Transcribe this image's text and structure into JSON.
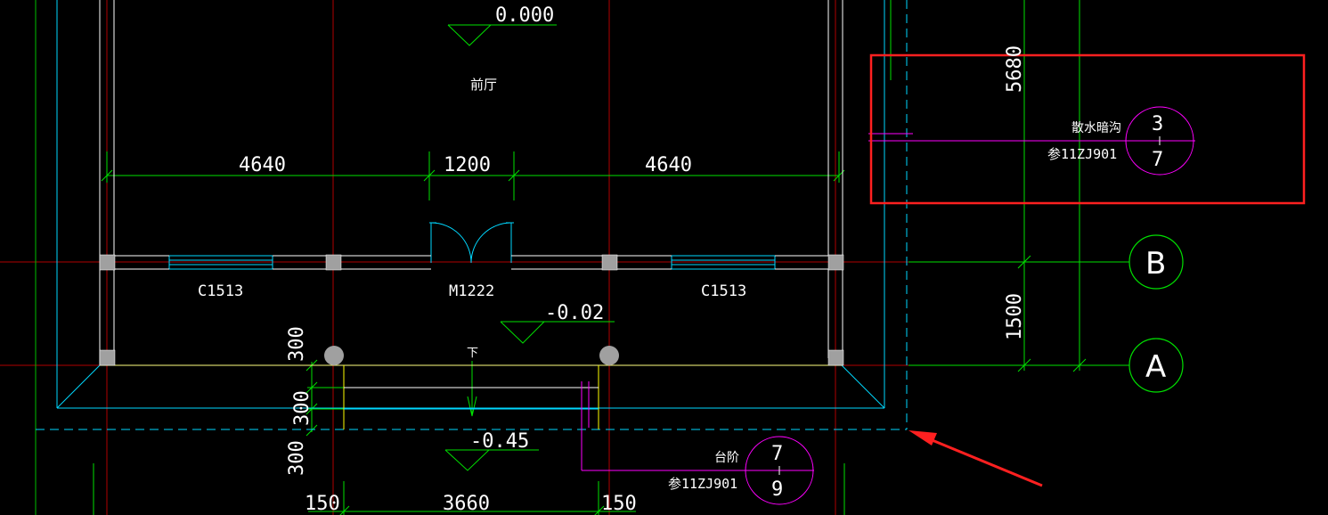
{
  "drawing": {
    "elevations": {
      "top": "0.000",
      "door": "-0.02",
      "bottom": "-0.45"
    },
    "room_label": "前厅",
    "dimensions": {
      "top_left": "4640",
      "top_mid": "1200",
      "top_right": "4640",
      "right_upper": "5680",
      "right_lower": "1500",
      "left_1": "300",
      "left_2": "300",
      "left_3": "300",
      "bottom_left": "150",
      "bottom_mid": "3660",
      "bottom_right": "150"
    },
    "openings": {
      "window_left": "C1513",
      "door": "M1222",
      "window_right": "C1513"
    },
    "stair_label": "下",
    "grid_bubbles": {
      "b": "B",
      "a": "A"
    },
    "detail_callouts": {
      "drain": {
        "title": "散水暗沟",
        "ref": "参11ZJ901",
        "num_top": "3",
        "num_bottom": "7"
      },
      "steps": {
        "title": "台阶",
        "ref": "参11ZJ901",
        "num_top": "7",
        "num_bottom": "9"
      }
    },
    "colors": {
      "background": "#000000",
      "wall": "#ffffff",
      "grid_axis": "#c00000",
      "dimension": "#00ff00",
      "cyan": "#00ffff",
      "magenta": "#ff00ff",
      "yellow": "#ffff00",
      "highlight": "#ff2020"
    }
  }
}
